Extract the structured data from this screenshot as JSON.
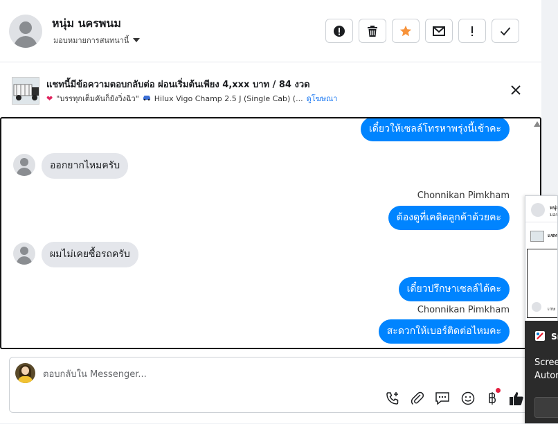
{
  "header": {
    "contact_name": "หนุ่ม นครพนม",
    "assign_label": "มอบหมายการสนทนานี้",
    "actions": [
      {
        "name": "spam-button",
        "icon": "exclamation-circle-icon"
      },
      {
        "name": "delete-button",
        "icon": "trash-icon"
      },
      {
        "name": "star-button",
        "icon": "star-icon",
        "color": "#f7923a"
      },
      {
        "name": "mark-unread-button",
        "icon": "envelope-icon"
      },
      {
        "name": "follow-up-button",
        "icon": "exclamation-icon"
      },
      {
        "name": "done-button",
        "icon": "check-icon"
      }
    ]
  },
  "ad": {
    "title": "แชทนี้มีข้อความตอบกลับต่อ ผ่อนเริ่มต้นเพียง 4,xxx บาท / 84 งวด",
    "subtitle_quote": "\"บรรทุกเต็มคันก็ยังวิ่งฉิว\"",
    "subtitle_model": "Hilux Vigo Champ 2.5 J (Single Cab) (...",
    "view_ad": "ดูโฆษณา"
  },
  "chat": {
    "messages": [
      {
        "type": "out",
        "text": "เดี๋ยวให้เซลล์โทรหาพรุ่งนี้เช้าคะ"
      },
      {
        "type": "in",
        "text": "ออกยากไหมครับ"
      },
      {
        "type": "sender",
        "text": "Chonnikan Pimkham"
      },
      {
        "type": "out",
        "text": "ต้องดูที่เคดิตลูกค้าด้วยคะ"
      },
      {
        "type": "in",
        "text": "ผมไม่เคยซื้อรถครับ"
      },
      {
        "type": "out",
        "text": "เดี๋ยวปรึกษาเซลล์ได้คะ"
      },
      {
        "type": "sender",
        "text": "Chonnikan Pimkham"
      },
      {
        "type": "out",
        "text": "สะดวกให้เบอร์ติดต่อไหมคะ"
      }
    ]
  },
  "composer": {
    "placeholder": "ตอบกลับใน Messenger...",
    "tools": [
      "phone-plus-icon",
      "paperclip-icon",
      "saved-reply-icon",
      "emoji-icon",
      "baht-icon",
      "thumbs-up-icon"
    ]
  },
  "side": {
    "mini_name": "หนุ่ม",
    "mini_sub": "มอบ",
    "mini_ad": "แชท",
    "mini_reply": "เกษ",
    "popup_title": "Sn",
    "popup_line1": "Scree",
    "popup_line2": "Autor"
  },
  "colors": {
    "accent": "#0084ff",
    "incoming_bubble": "#e4e6eb",
    "star": "#f7923a"
  }
}
